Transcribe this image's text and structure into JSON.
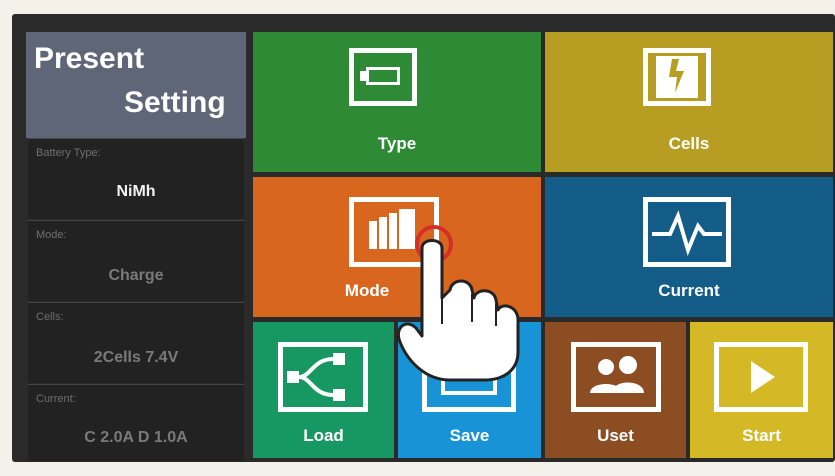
{
  "panel": {
    "header_line1": "Present",
    "header_line2": "Setting",
    "fields": [
      {
        "label": "Battery Type:",
        "value": "NiMh"
      },
      {
        "label": "Mode:",
        "value": "Charge"
      },
      {
        "label": "Cells:",
        "value": "2Cells  7.4V"
      },
      {
        "label": "Current:",
        "value": "C 2.0A  D 1.0A"
      }
    ]
  },
  "tiles": {
    "type": {
      "label": "Type",
      "color": "#2f8a36",
      "icon": "battery-icon"
    },
    "cells": {
      "label": "Cells",
      "color": "#b79e23",
      "icon": "lightning-icon"
    },
    "mode": {
      "label": "Mode",
      "color": "#d9661e",
      "icon": "documents-icon"
    },
    "current": {
      "label": "Current",
      "color": "#135d88",
      "icon": "waveform-icon"
    },
    "load": {
      "label": "Load",
      "color": "#179761",
      "icon": "network-icon"
    },
    "save": {
      "label": "Save",
      "color": "#1793d6",
      "icon": "save-icon"
    },
    "uset": {
      "label": "Uset",
      "color": "#8c4d23",
      "icon": "users-icon"
    },
    "start": {
      "label": "Start",
      "color": "#d4b825",
      "icon": "play-icon"
    }
  }
}
